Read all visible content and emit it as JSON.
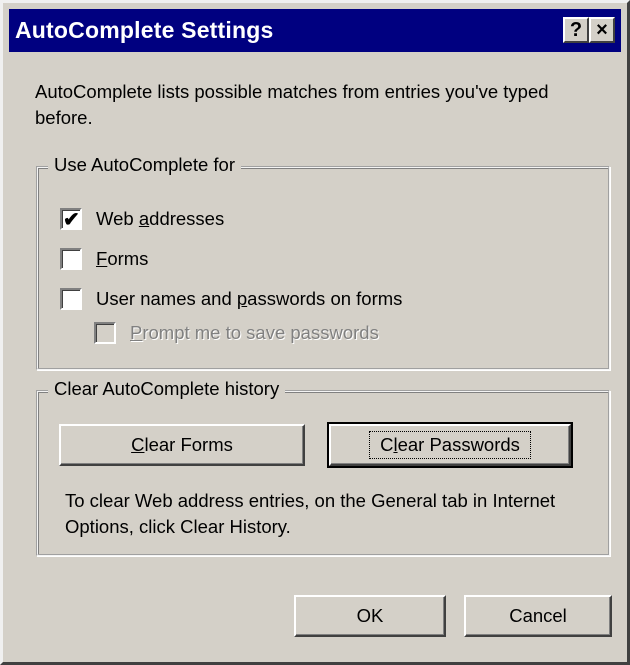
{
  "window": {
    "title": "AutoComplete Settings",
    "help_button": "?",
    "close_button": "×"
  },
  "description": "AutoComplete lists possible matches from entries you've typed before.",
  "use_group": {
    "label": "Use AutoComplete for",
    "items": [
      {
        "label": "Web addresses",
        "checked": true,
        "enabled": true
      },
      {
        "label": "Forms",
        "checked": false,
        "enabled": true
      },
      {
        "label": "User names and passwords on forms",
        "checked": false,
        "enabled": true
      },
      {
        "label": "Prompt me to save passwords",
        "checked": false,
        "enabled": false
      }
    ]
  },
  "clear_group": {
    "label": "Clear AutoComplete history",
    "clear_forms": "Clear Forms",
    "clear_passwords": "Clear Passwords",
    "hint": "To clear Web address entries, on the General tab in Internet Options, click Clear History."
  },
  "footer": {
    "ok": "OK",
    "cancel": "Cancel"
  }
}
